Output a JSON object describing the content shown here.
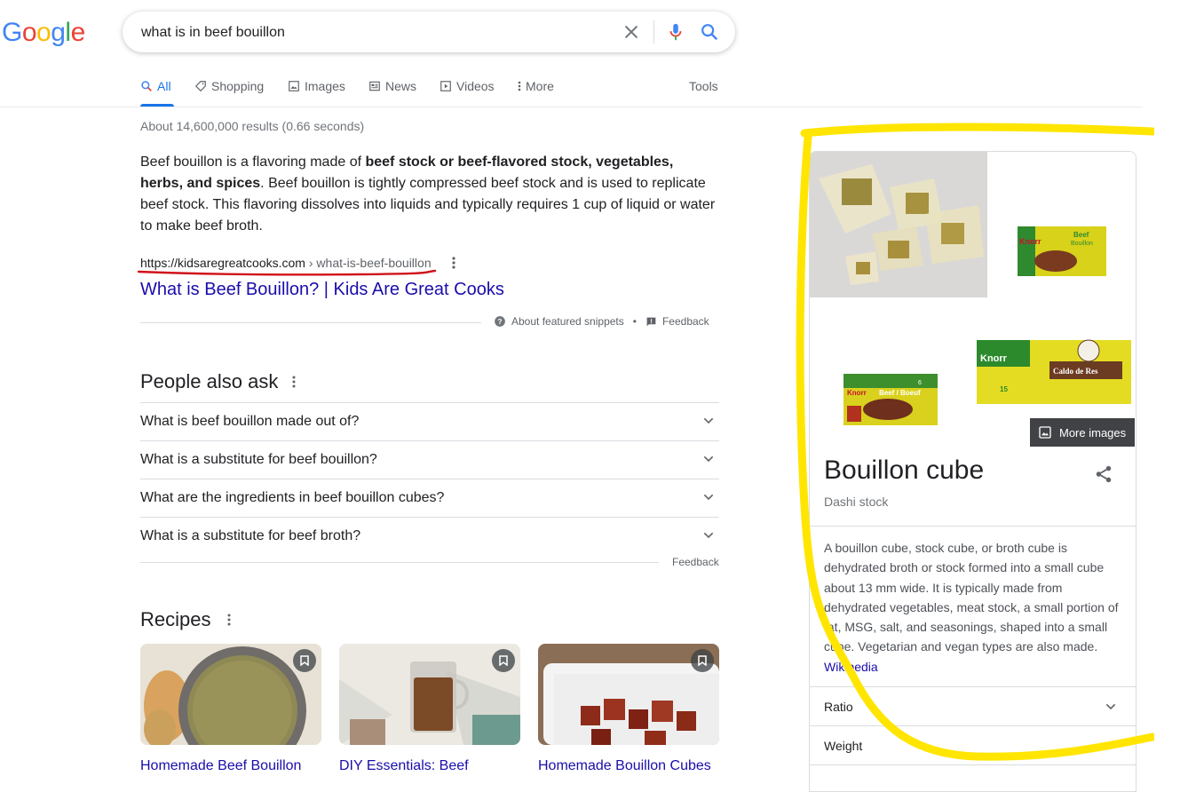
{
  "logo": {
    "letters": [
      "G",
      "o",
      "o",
      "g",
      "l",
      "e"
    ],
    "colors": [
      "#4285F4",
      "#EA4335",
      "#FBBC05",
      "#4285F4",
      "#34A853",
      "#EA4335"
    ]
  },
  "search": {
    "query": "what is in beef bouillon"
  },
  "tabs": [
    {
      "label": "All",
      "active": true
    },
    {
      "label": "Shopping"
    },
    {
      "label": "Images"
    },
    {
      "label": "News"
    },
    {
      "label": "Videos"
    },
    {
      "label": "More"
    },
    {
      "label": "Tools"
    }
  ],
  "results": {
    "stats": "About 14,600,000 results (0.66 seconds)",
    "snippet": {
      "text_1": "Beef bouillon is a flavoring made of ",
      "bold": "beef stock or beef-flavored stock, vegetables, herbs, and spices",
      "text_2": ". Beef bouillon is tightly compressed beef stock and is used to replicate beef stock. This flavoring dissolves into liquids and typically requires 1 cup of liquid or water to make beef broth."
    },
    "cite_domain": "https://kidsaregreatcooks.com",
    "cite_path": " › what-is-beef-bouillon",
    "title": "What is Beef Bouillon? | Kids Are Great Cooks",
    "about_snippets": "About featured snippets",
    "bullet": "•",
    "feedback": "Feedback"
  },
  "paa": {
    "heading": "People also ask",
    "questions": [
      "What is beef bouillon made out of?",
      "What is a substitute for beef bouillon?",
      "What are the ingredients in beef bouillon cubes?",
      "What is a substitute for beef broth?"
    ],
    "feedback": "Feedback"
  },
  "recipes": {
    "heading": "Recipes",
    "items": [
      {
        "title": "Homemade Beef Bouillon"
      },
      {
        "title": "DIY Essentials: Beef"
      },
      {
        "title": "Homemade Bouillon Cubes"
      }
    ]
  },
  "knowledge_panel": {
    "more_images": "More images",
    "title": "Bouillon cube",
    "subtitle": "Dashi stock",
    "description": "A bouillon cube, stock cube, or broth cube is dehydrated broth or stock formed into a small cube about 13 mm wide. It is typically made from dehydrated vegetables, meat stock, a small portion of fat, MSG, salt, and seasonings, shaped into a small cube. Vegetarian and vegan types are also made.",
    "source": "Wikipedia",
    "rows": [
      "Ratio",
      "Weight"
    ],
    "package_text": {
      "brand": "Knorr",
      "beef": "Beef",
      "bouillon": "Bouillon",
      "six": "6",
      "beef_boeuf": "Beef / Boeuf",
      "caldo": "Caldo de Res",
      "fifteen": "15"
    }
  },
  "colors": {
    "accent": "#1a73e8",
    "link": "#1a0dab",
    "highlight": "#FFE500",
    "annotation": "#D0121B"
  }
}
